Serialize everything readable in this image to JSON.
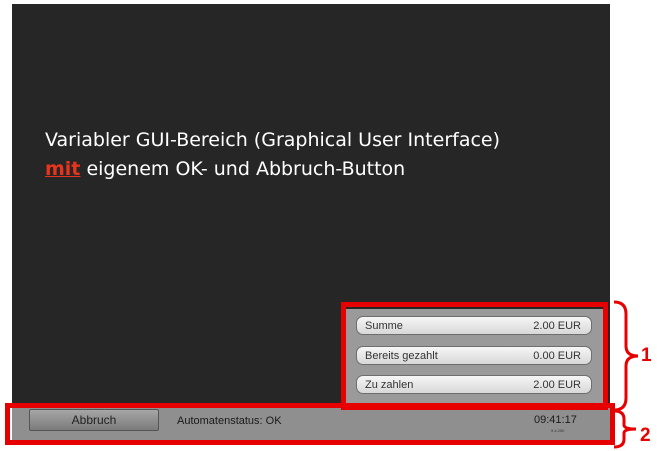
{
  "gui_area": {
    "line1": "Variabler GUI-Bereich (Graphical User Interface)",
    "mit": "mit",
    "line2_rest": " eigenem OK- und Abbruch-Button"
  },
  "summary": {
    "rows": [
      {
        "label": "Summe",
        "value": "2.00 EUR"
      },
      {
        "label": "Bereits gezahlt",
        "value": "0.00 EUR"
      },
      {
        "label": "Zu zahlen",
        "value": "2.00 EUR"
      }
    ]
  },
  "status_bar": {
    "cancel_label": "Abbruch",
    "status_text": "Automatenstatus: OK",
    "time": "09:41:17",
    "time_sub": "9.4.200"
  },
  "annotations": {
    "label1": "1",
    "label2": "2"
  },
  "colors": {
    "highlight": "#e60000",
    "screen_bg": "#262626"
  }
}
